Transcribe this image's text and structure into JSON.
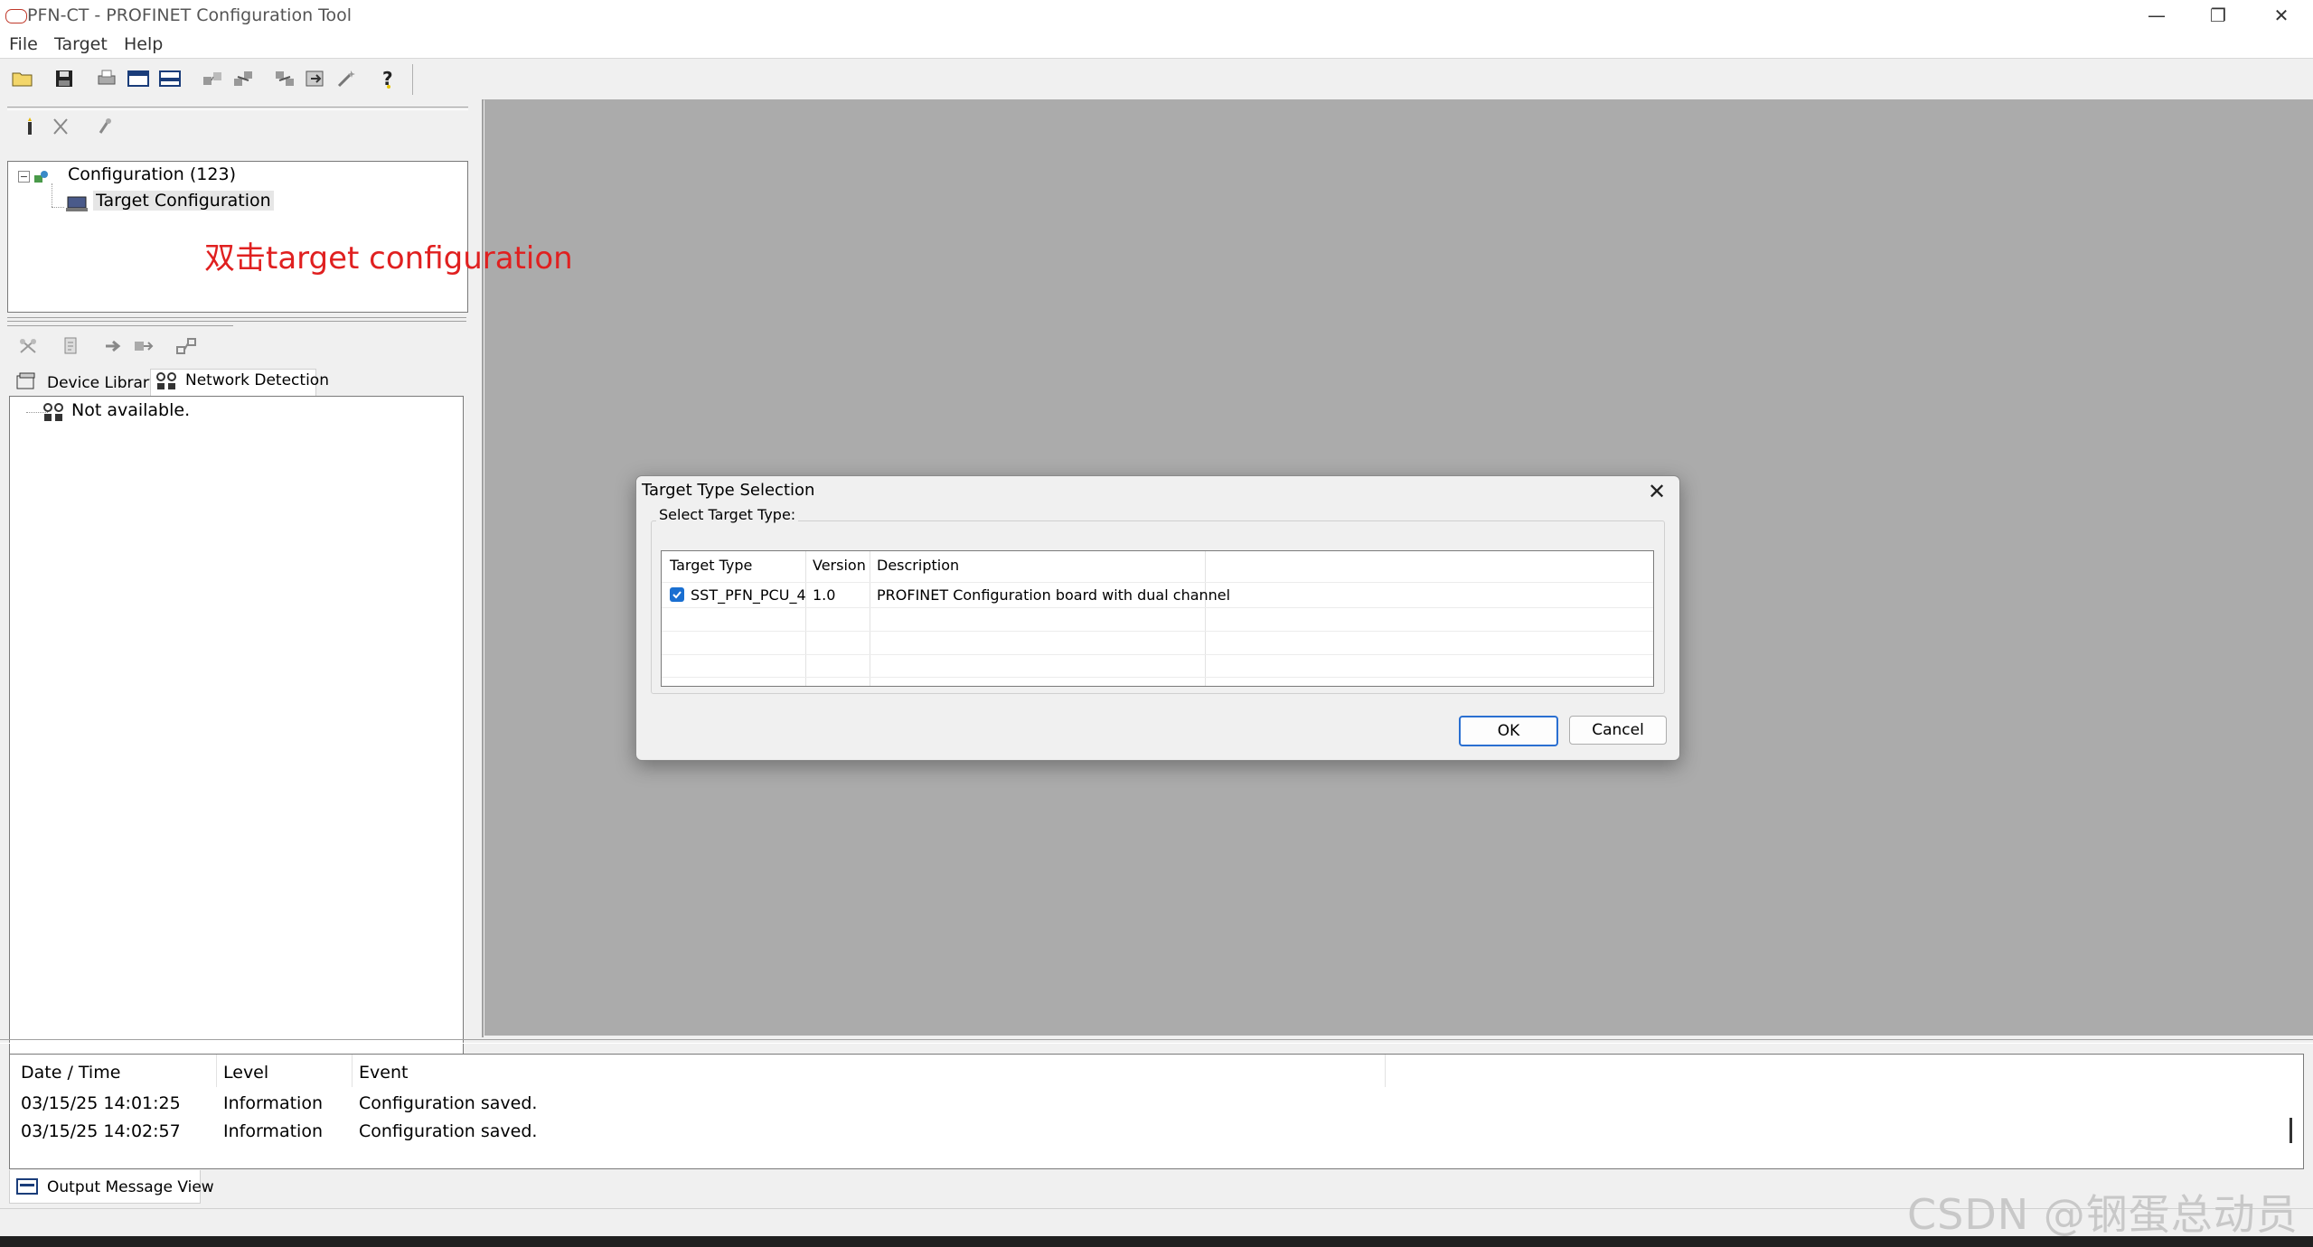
{
  "window": {
    "title": "PFN-CT - PROFINET Configuration Tool",
    "minimize": "—",
    "restore": "❐",
    "close": "✕"
  },
  "menubar": {
    "items": [
      "File",
      "Target",
      "Help"
    ]
  },
  "toolbar": {
    "icons": [
      "open-icon",
      "save-icon",
      "print-icon",
      "view1-icon",
      "view2-icon",
      "network-icon",
      "upload-icon",
      "download-icon",
      "export-icon",
      "wizard-icon",
      "help-icon"
    ]
  },
  "tree": {
    "root": "Configuration (123)",
    "child": "Target Configuration"
  },
  "annotation": "双击target configuration",
  "lower_tabs": {
    "device_library": "Device Library",
    "network_detection": "Network Detection"
  },
  "network_tree": {
    "item": "Not available."
  },
  "dialog": {
    "title": "Target Type Selection",
    "group_label": "Select Target Type:",
    "columns": [
      "Target Type",
      "Version",
      "Description"
    ],
    "rows": [
      {
        "target_type": "SST_PFN_PCU_4",
        "version": "1.0",
        "description": "PROFINET Configuration board with dual channel",
        "checked": true
      }
    ],
    "ok": "OK",
    "cancel": "Cancel"
  },
  "output": {
    "columns": [
      "Date / Time",
      "Level",
      "Event"
    ],
    "rows": [
      {
        "datetime": "03/15/25 14:01:25",
        "level": "Information",
        "event": "Configuration saved."
      },
      {
        "datetime": "03/15/25 14:02:57",
        "level": "Information",
        "event": "Configuration saved."
      }
    ],
    "tab": "Output Message View"
  },
  "watermark": "CSDN @钢蛋总动员",
  "colors": {
    "mdi_background": "#ababab",
    "annotation": "#e02020",
    "checkbox": "#1a6fd1"
  }
}
